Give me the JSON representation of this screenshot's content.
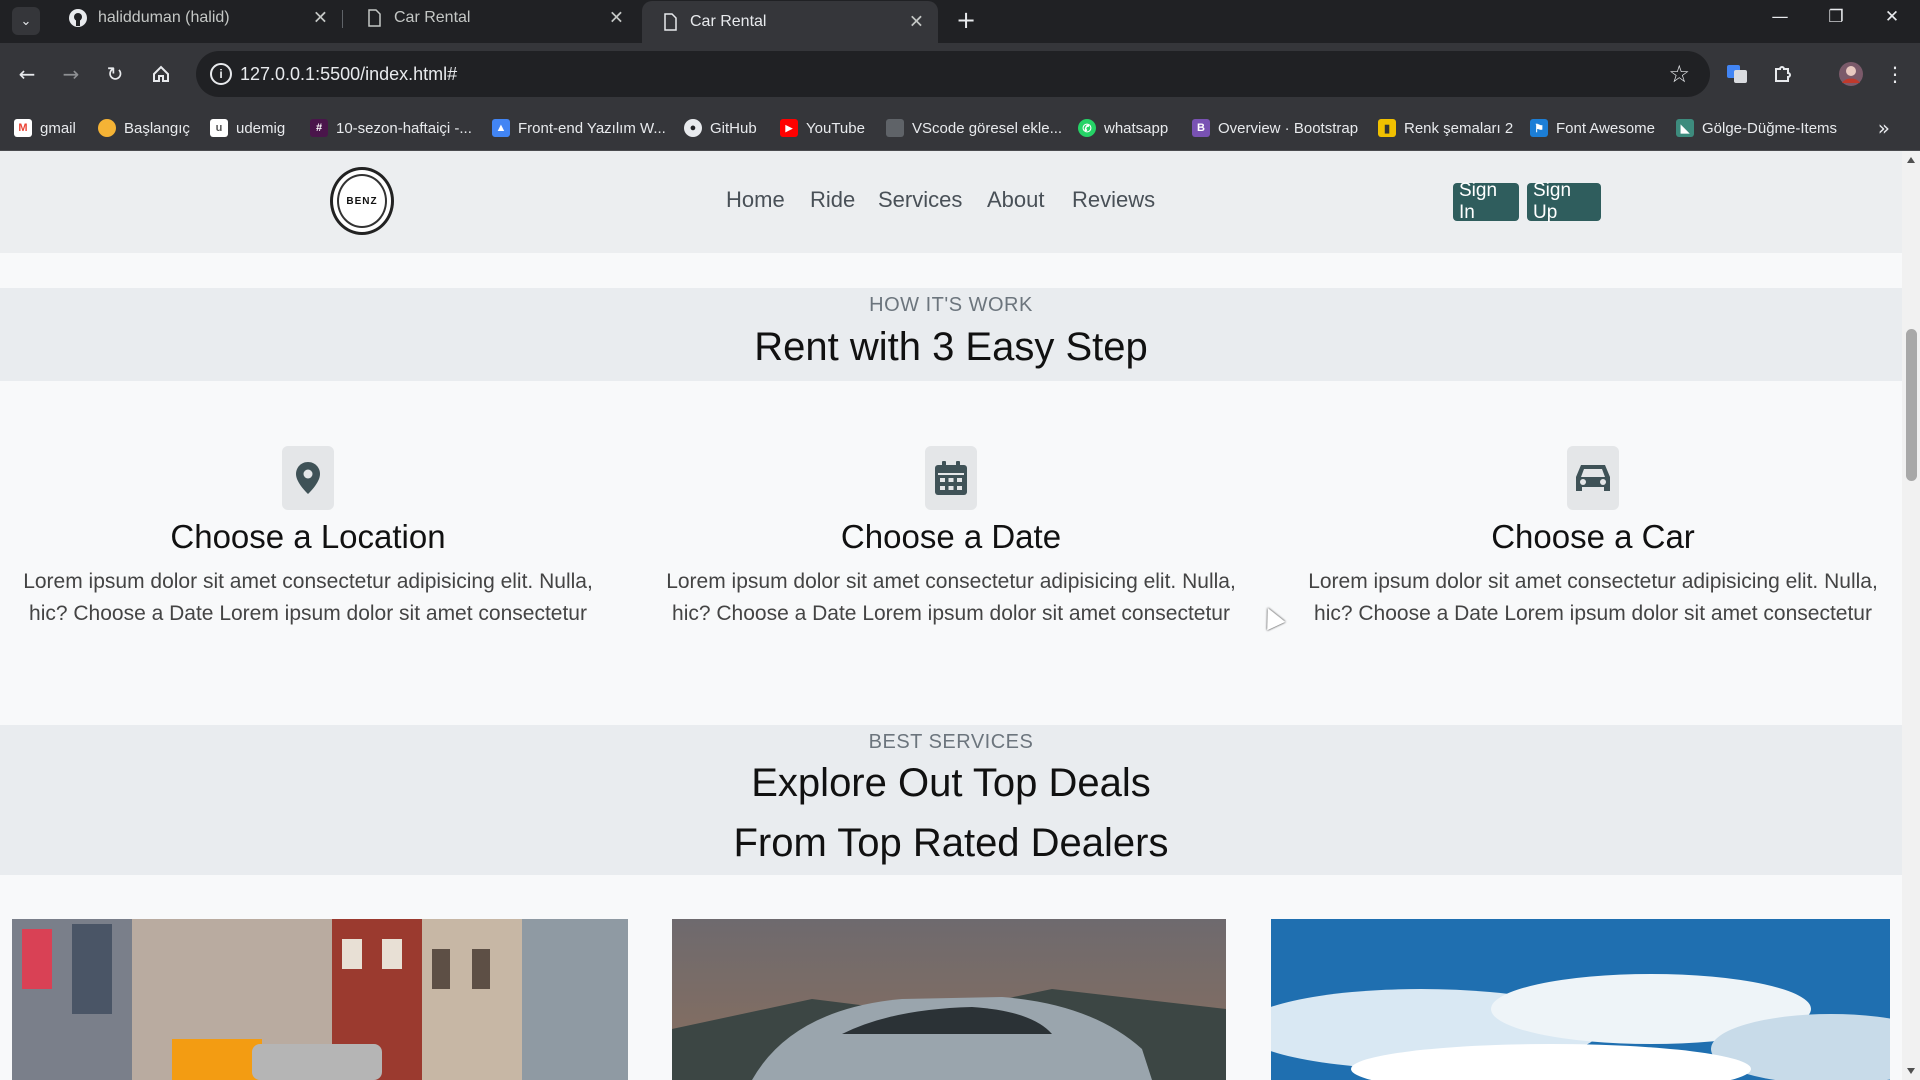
{
  "browser": {
    "tabs": [
      {
        "title": "halidduman (halid)",
        "active": false
      },
      {
        "title": "Car Rental",
        "active": false
      },
      {
        "title": "Car Rental",
        "active": true
      }
    ],
    "url": "127.0.0.1:5500/index.html#",
    "bookmarks": [
      {
        "label": "gmail",
        "icon": "gmail-icon",
        "color": "#ea4335"
      },
      {
        "label": "Başlangıç",
        "icon": "start-icon",
        "color": "#f5b335"
      },
      {
        "label": "udemig",
        "icon": "udemig-icon",
        "color": "#ffffff"
      },
      {
        "label": "10-sezon-haftaiçi -...",
        "icon": "slack-icon",
        "color": "#e01e5a"
      },
      {
        "label": "Front-end Yazılım W...",
        "icon": "classroom-icon",
        "color": "#4285f4"
      },
      {
        "label": "GitHub",
        "icon": "github-icon",
        "color": "#ffffff"
      },
      {
        "label": "YouTube",
        "icon": "youtube-icon",
        "color": "#ff0000"
      },
      {
        "label": "VScode göresel ekle...",
        "icon": "vscode-icon",
        "color": "#5f6368"
      },
      {
        "label": "whatsapp",
        "icon": "whatsapp-icon",
        "color": "#25d366"
      },
      {
        "label": "Overview · Bootstrap",
        "icon": "bootstrap-icon",
        "color": "#7952b3"
      },
      {
        "label": "Renk şemaları 2",
        "icon": "palette-icon",
        "color": "#f0c000"
      },
      {
        "label": "Font Awesome",
        "icon": "font-awesome-icon",
        "color": "#1c7ed6"
      },
      {
        "label": "Gölge-Düğme-Items",
        "icon": "shadow-icon",
        "color": "#3d8b7d"
      }
    ]
  },
  "site": {
    "logo_text": "BENZ",
    "nav": [
      "Home",
      "Ride",
      "Services",
      "About",
      "Reviews"
    ],
    "sign_in": "Sign In",
    "sign_up": "Sign Up",
    "accent": "#2f5d5d"
  },
  "how": {
    "eyebrow": "HOW IT'S WORK",
    "title": "Rent with 3 Easy Step",
    "steps": [
      {
        "icon": "map-pin-icon",
        "title": "Choose a Location",
        "text": "Lorem ipsum dolor sit amet consectetur adipisicing elit. Nulla, hic? Choose a Date Lorem ipsum dolor sit amet consectetur"
      },
      {
        "icon": "calendar-icon",
        "title": "Choose a Date",
        "text": "Lorem ipsum dolor sit amet consectetur adipisicing elit. Nulla, hic? Choose a Date Lorem ipsum dolor sit amet consectetur"
      },
      {
        "icon": "car-icon",
        "title": "Choose a Car",
        "text": "Lorem ipsum dolor sit amet consectetur adipisicing elit. Nulla, hic? Choose a Date Lorem ipsum dolor sit amet consectetur"
      }
    ]
  },
  "services": {
    "eyebrow": "BEST SERVICES",
    "title_line1": "Explore Out Top Deals",
    "title_line2": "From Top Rated Dealers"
  }
}
